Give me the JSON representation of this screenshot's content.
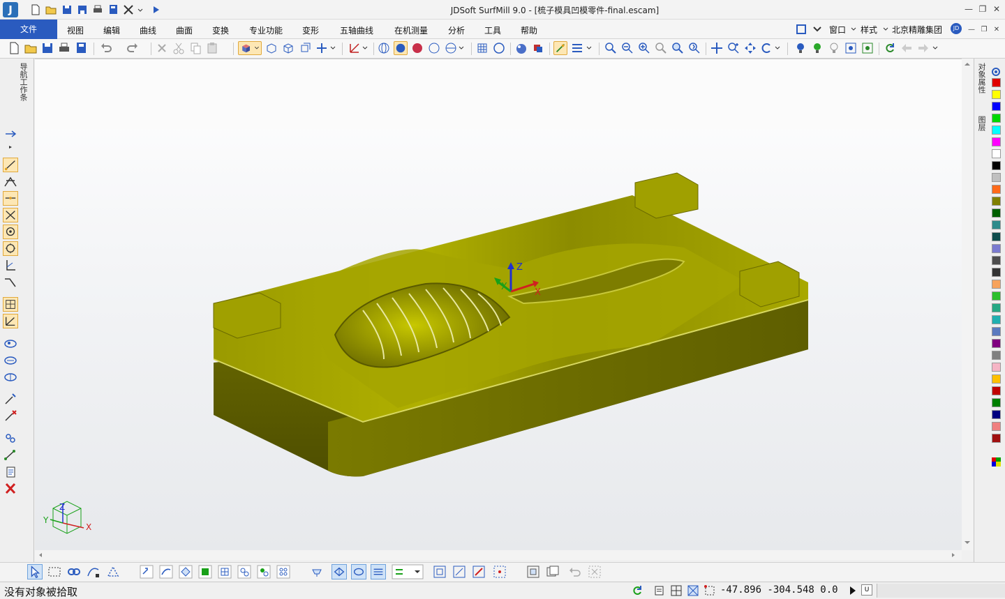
{
  "window": {
    "title": "JDSoft SurfMill 9.0 - [梳子模具凹模零件-final.escam]",
    "app_icon_letter": "J",
    "controls": [
      "—",
      "❐",
      "✕"
    ]
  },
  "menu": {
    "file": "文件",
    "items": [
      "视图",
      "编辑",
      "曲线",
      "曲面",
      "变换",
      "专业功能",
      "变形",
      "五轴曲线",
      "在机测量",
      "分析",
      "工具",
      "帮助"
    ],
    "right": {
      "window": "窗口",
      "style": "样式",
      "company": "北京精雕集团",
      "avatar": "JD"
    },
    "mdi_controls": [
      "—",
      "❐",
      "✕"
    ]
  },
  "left_panel": {
    "tab_label": "导航工作条"
  },
  "right_panel": {
    "tab_object_props": "对象属性",
    "tab_layers": "图层"
  },
  "viewport": {
    "axis_labels": {
      "x": "X",
      "y": "Y",
      "z": "Z"
    },
    "triad_labels": {
      "x": "X",
      "y": "Y",
      "z": "Z"
    }
  },
  "palette": {
    "colors": [
      "#e00000",
      "#ffff00",
      "#0000ff",
      "#00d800",
      "#00ffff",
      "#ff00ff",
      "#ffffff",
      "#000000",
      "#c0c0c0",
      "#ff6a1a",
      "#808000",
      "#006000",
      "#2e8b8b",
      "#0e4d4d",
      "#7b7bd0",
      "#4d4d4d",
      "#333333",
      "#f7a35c",
      "#2bbf2b",
      "#26a884",
      "#20b0b0",
      "#5a7abf",
      "#800080",
      "#808080",
      "#f5b5c5",
      "#ffc000",
      "#c00000",
      "#008000",
      "#000080",
      "#f08080",
      "#a01010"
    ]
  },
  "status": {
    "message": "没有对象被拾取",
    "coords": "-47.896 -304.548 0.0",
    "unit": "U"
  },
  "model_color": "#8a8a00"
}
